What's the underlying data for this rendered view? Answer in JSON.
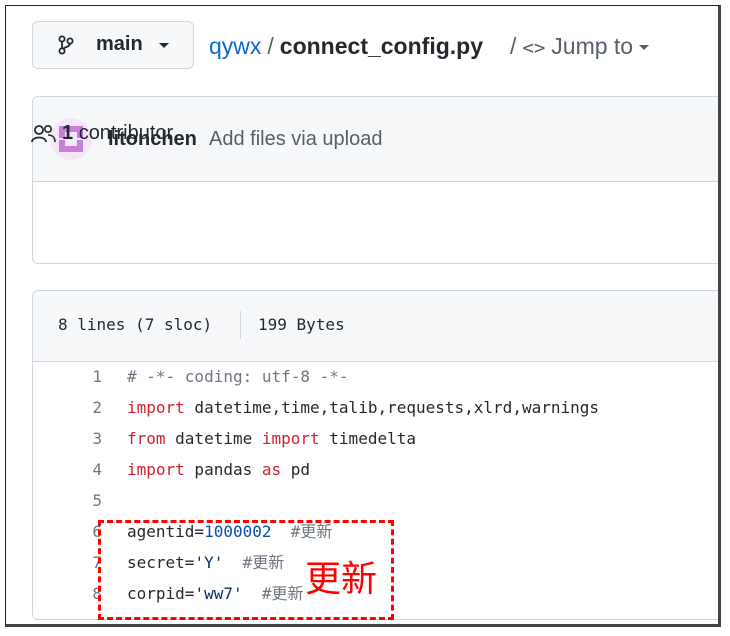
{
  "header": {
    "branch": "main",
    "repo": "qywx",
    "separator": "/",
    "file": "connect_config.py",
    "jump_prefix": "/",
    "jump_code": "<>",
    "jump_label": "Jump to"
  },
  "commit": {
    "author": "litonchen",
    "message": "Add files via upload",
    "contributors_count": "1",
    "contributors_label": "contributor"
  },
  "file": {
    "lines_info": "8 lines (7 sloc)",
    "size": "199 Bytes",
    "lines": [
      {
        "n": "1",
        "code": [
          {
            "t": "# -*- coding: utf-8 -*-",
            "c": "cm"
          }
        ]
      },
      {
        "n": "2",
        "code": [
          {
            "t": "import",
            "c": "kw"
          },
          {
            "t": " datetime,time,talib,requests,xlrd,warnings",
            "c": "pl"
          }
        ]
      },
      {
        "n": "3",
        "code": [
          {
            "t": "from",
            "c": "kw"
          },
          {
            "t": " datetime ",
            "c": "pl"
          },
          {
            "t": "import",
            "c": "kw"
          },
          {
            "t": " timedelta",
            "c": "pl"
          }
        ]
      },
      {
        "n": "4",
        "code": [
          {
            "t": "import",
            "c": "kw"
          },
          {
            "t": " pandas ",
            "c": "pl"
          },
          {
            "t": "as",
            "c": "kw"
          },
          {
            "t": " pd",
            "c": "pl"
          }
        ]
      },
      {
        "n": "5",
        "code": []
      },
      {
        "n": "6",
        "code": [
          {
            "t": "agentid=",
            "c": "pl"
          },
          {
            "t": "1000002",
            "c": "num"
          },
          {
            "t": "  #更新",
            "c": "cm"
          }
        ]
      },
      {
        "n": "7",
        "code": [
          {
            "t": "secret=",
            "c": "pl"
          },
          {
            "t": "'Y'",
            "c": "str"
          },
          {
            "t": "  #更新",
            "c": "cm"
          }
        ]
      },
      {
        "n": "8",
        "code": [
          {
            "t": "corpid=",
            "c": "pl"
          },
          {
            "t": "'ww7'",
            "c": "str"
          },
          {
            "t": "  #更新",
            "c": "cm"
          }
        ]
      }
    ]
  },
  "annotation": {
    "note": "更新",
    "color": "#ff0000"
  },
  "colors": {
    "link": "#0969da",
    "keyword": "#cf222e",
    "comment": "#6e7781",
    "number": "#0550ae",
    "string": "#0a3069"
  },
  "icons": [
    "git-branch-icon",
    "caret-down-icon",
    "avatar",
    "people-icon"
  ]
}
